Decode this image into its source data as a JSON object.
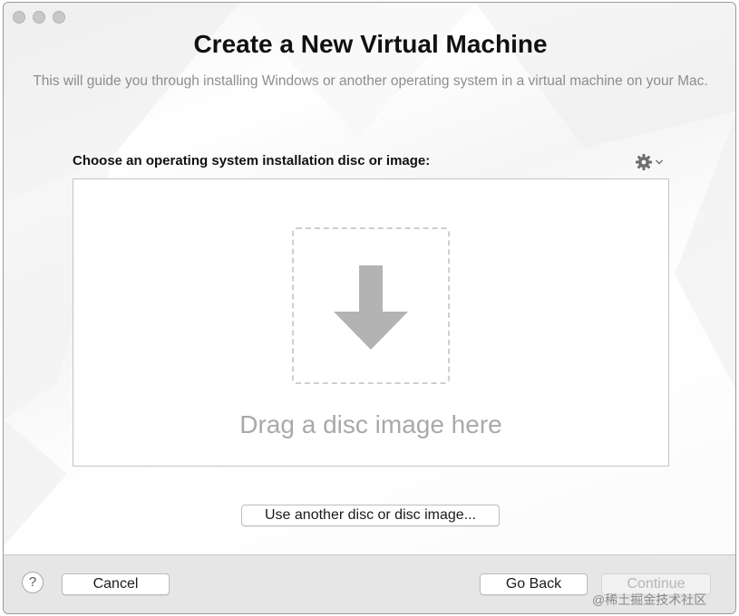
{
  "window": {
    "title": "Create a New Virtual Machine",
    "subtitle": "This will guide you through installing Windows or another operating system in a virtual machine on your Mac."
  },
  "installer": {
    "choose_label": "Choose an operating system installation disc or image:",
    "gear_icon": "gear-icon",
    "drop_text": "Drag a disc image here",
    "drop_icon": "down-arrow-icon",
    "other_disc_button": "Use another disc or disc image..."
  },
  "footer": {
    "help_label": "?",
    "cancel_label": "Cancel",
    "back_label": "Go Back",
    "continue_label": "Continue"
  },
  "watermark": "@稀土掘金技术社区"
}
